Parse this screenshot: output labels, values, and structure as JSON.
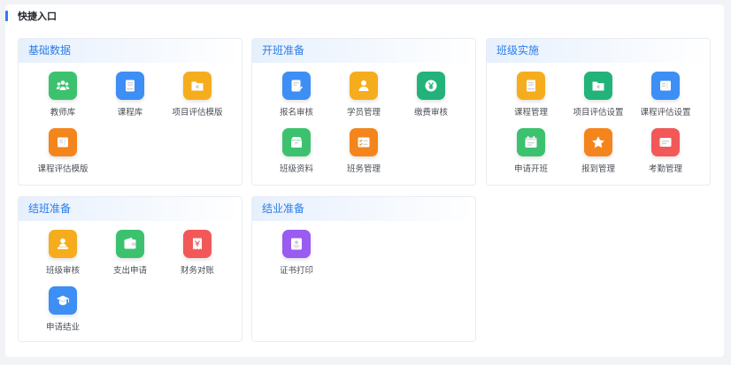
{
  "panel": {
    "title": "快捷入口"
  },
  "sections": [
    {
      "title": "基础数据",
      "items": [
        {
          "label": "教师库",
          "color": "#3cc26f",
          "icon": "users-icon"
        },
        {
          "label": "课程库",
          "color": "#3d8ef5",
          "icon": "book-icon"
        },
        {
          "label": "项目评估模版",
          "color": "#f5ad1e",
          "icon": "folder-star-icon"
        },
        {
          "label": "课程评估模版",
          "color": "#f4851c",
          "icon": "book-open-icon"
        }
      ]
    },
    {
      "title": "开班准备",
      "items": [
        {
          "label": "报名审核",
          "color": "#3d8ef5",
          "icon": "edit-doc-icon"
        },
        {
          "label": "学员管理",
          "color": "#f5ad1e",
          "icon": "user-icon"
        },
        {
          "label": "缴费审核",
          "color": "#22b37a",
          "icon": "yen-icon"
        },
        {
          "label": "班级资料",
          "color": "#3cc26f",
          "icon": "archive-icon"
        },
        {
          "label": "班务管理",
          "color": "#f4851c",
          "icon": "list-check-icon"
        }
      ]
    },
    {
      "title": "班级实施",
      "items": [
        {
          "label": "课程管理",
          "color": "#f5ad1e",
          "icon": "book-icon"
        },
        {
          "label": "项目评估设置",
          "color": "#22b37a",
          "icon": "folder-star-icon"
        },
        {
          "label": "课程评估设置",
          "color": "#3d8ef5",
          "icon": "book-open-icon"
        },
        {
          "label": "申请开班",
          "color": "#3cc26f",
          "icon": "calendar-icon"
        },
        {
          "label": "报到管理",
          "color": "#f4851c",
          "icon": "star-icon"
        },
        {
          "label": "考勤管理",
          "color": "#f25858",
          "icon": "id-card-icon"
        }
      ]
    },
    {
      "title": "结班准备",
      "items": [
        {
          "label": "班级审核",
          "color": "#f5ad1e",
          "icon": "user-stamp-icon"
        },
        {
          "label": "支出申请",
          "color": "#3cc26f",
          "icon": "wallet-icon"
        },
        {
          "label": "财务对账",
          "color": "#f25858",
          "icon": "receipt-icon"
        },
        {
          "label": "申请结业",
          "color": "#3d8ef5",
          "icon": "graduation-cap-icon"
        }
      ]
    },
    {
      "title": "结业准备",
      "items": [
        {
          "label": "证书打印",
          "color": "#9a5bf0",
          "icon": "certificate-icon"
        }
      ]
    }
  ]
}
